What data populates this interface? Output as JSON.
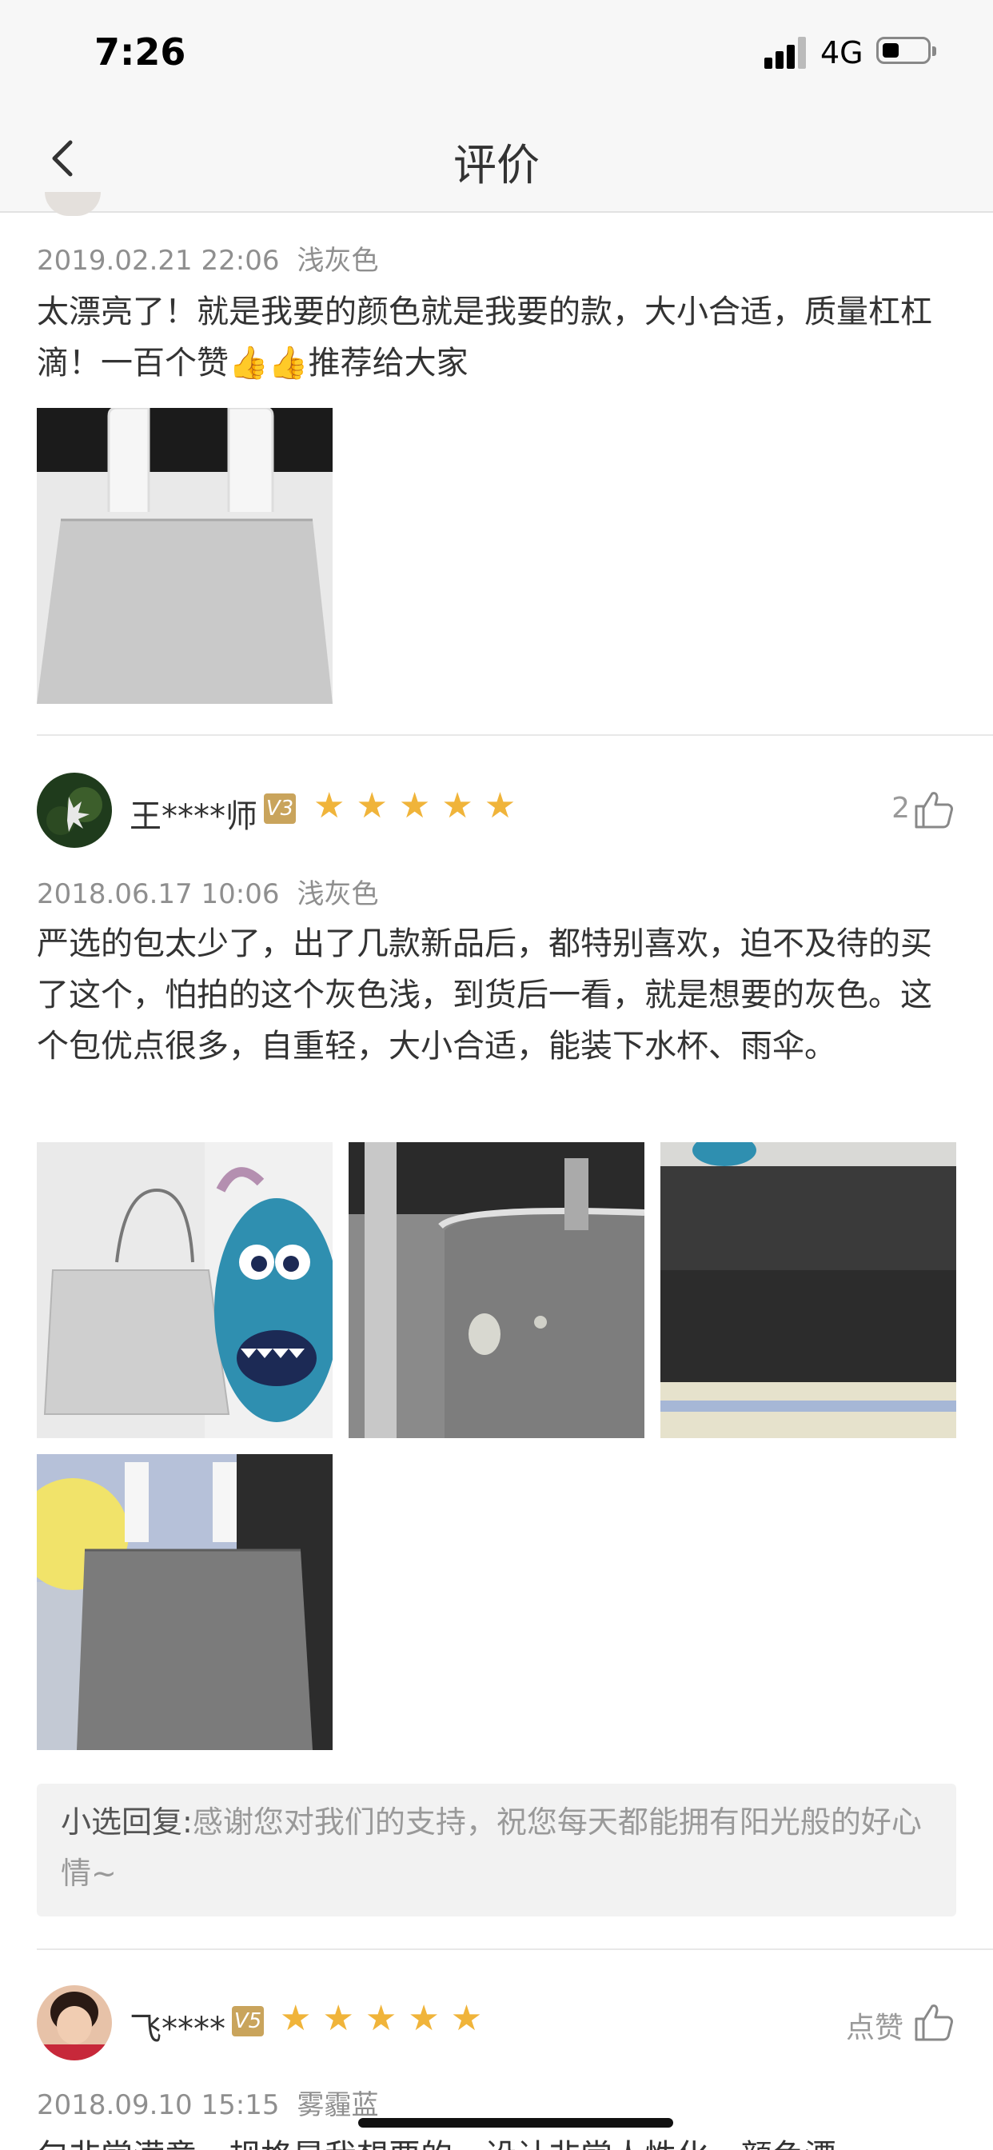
{
  "status_bar": {
    "time": "7:26",
    "network": "4G"
  },
  "nav": {
    "title": "评价"
  },
  "reviews": [
    {
      "date": "2019.02.21 22:06",
      "spec": "浅灰色",
      "text": "太漂亮了！就是我要的颜色就是我要的款，大小合适，质量杠杠滴！一百个赞👍👍推荐给大家",
      "image_count": 1
    },
    {
      "user": "王****师",
      "vip": "V3",
      "rating": 5,
      "likes": "2",
      "date": "2018.06.17 10:06",
      "spec": "浅灰色",
      "text": "严选的包太少了，出了几款新品后，都特别喜欢，迫不及待的买了这个，怕拍的这个灰色浅，到货后一看，就是想要的灰色。这个包优点很多，自重轻，大小合适，能装下水杯、雨伞。",
      "image_count": 4,
      "reply_label": "小选回复:",
      "reply_text": "感谢您对我们的支持，祝您每天都能拥有阳光般的好心情~"
    },
    {
      "user": "飞****",
      "vip": "V5",
      "rating": 5,
      "likes": "点赞",
      "date": "2018.09.10 15:15",
      "spec": "雾霾蓝",
      "text": "包非常满意，规格是我想要的，设计非常人性化，颜色漂"
    }
  ],
  "colors": {
    "star": "#f0b43a",
    "badge": "#c9a45c",
    "meta": "#8f8f8f"
  }
}
